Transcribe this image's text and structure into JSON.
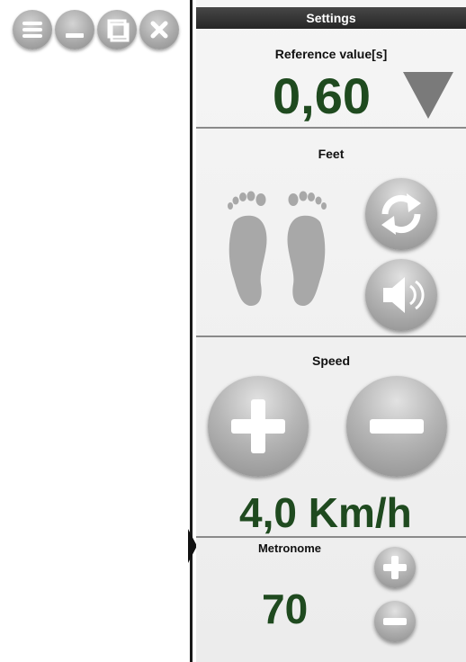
{
  "window_controls": {
    "menu_icon": "hamburger-menu-icon",
    "minimize_icon": "minimize-icon",
    "maximize_icon": "maximize-icon",
    "close_icon": "close-icon"
  },
  "settings": {
    "header": "Settings",
    "reference": {
      "label": "Reference value[s]",
      "value": "0,60",
      "dropdown_icon": "triangle-down-icon"
    },
    "feet": {
      "label": "Feet",
      "swap_icon": "swap-arrows-icon",
      "sound_icon": "speaker-icon",
      "feet_icon": "footprints-icon"
    },
    "speed": {
      "label": "Speed",
      "value": "4,0 Km/h",
      "increase_icon": "plus-icon",
      "decrease_icon": "minus-icon"
    },
    "metronome": {
      "label": "Metronome",
      "value": "70",
      "increase_icon": "plus-icon",
      "decrease_icon": "minus-icon"
    }
  },
  "colors": {
    "value_green": "#1f4a1f",
    "header_bg": "#333333",
    "button_gray": "#a9a9a9"
  }
}
